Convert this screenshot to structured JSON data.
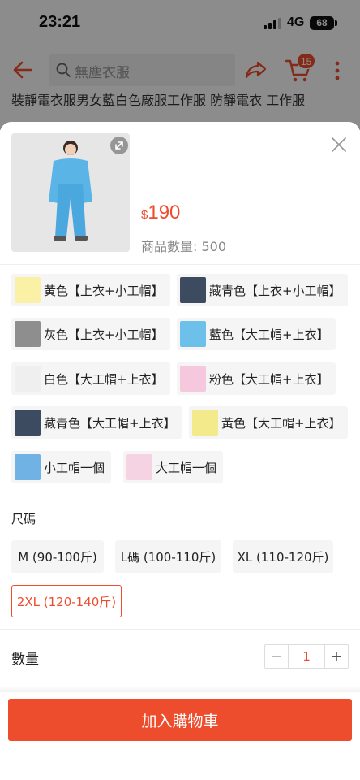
{
  "status_bar": {
    "time": "23:21",
    "network": "4G",
    "battery": "68"
  },
  "header": {
    "search_placeholder": "無塵衣服",
    "cart_count": "15"
  },
  "background_title": "裝靜電衣服男女藍白色廠服工作服 防靜電衣 工作服",
  "product": {
    "currency": "$",
    "price": "190",
    "stock_label": "商品數量: 500"
  },
  "variations": [
    {
      "label": "黃色【上衣+小工帽】",
      "thumb": "yellow"
    },
    {
      "label": "藏青色【上衣+小工帽】",
      "thumb": "navy"
    },
    {
      "label": "灰色【上衣+小工帽】",
      "thumb": "gray"
    },
    {
      "label": "藍色【大工帽+上衣】",
      "thumb": "blue"
    },
    {
      "label": "白色【大工帽+上衣】",
      "thumb": "white"
    },
    {
      "label": "粉色【大工帽+上衣】",
      "thumb": "pink"
    },
    {
      "label": "藏青色【大工帽+上衣】",
      "thumb": "navy"
    },
    {
      "label": "黃色【大工帽+上衣】",
      "thumb": "yellow"
    },
    {
      "label": "小工帽一個",
      "thumb": "caps"
    },
    {
      "label": "大工帽一個",
      "thumb": "bigcaps"
    }
  ],
  "size_section": {
    "title": "尺碼",
    "options": [
      "M (90-100斤)",
      "L碼 (100-110斤)",
      "XL (110-120斤)",
      "2XL (120-140斤)"
    ],
    "selected": "2XL (120-140斤)"
  },
  "quantity": {
    "label": "數量",
    "value": "1",
    "minus": "−",
    "plus": "+"
  },
  "add_to_cart": "加入購物車",
  "colors": {
    "accent": "#ee4d2d"
  }
}
